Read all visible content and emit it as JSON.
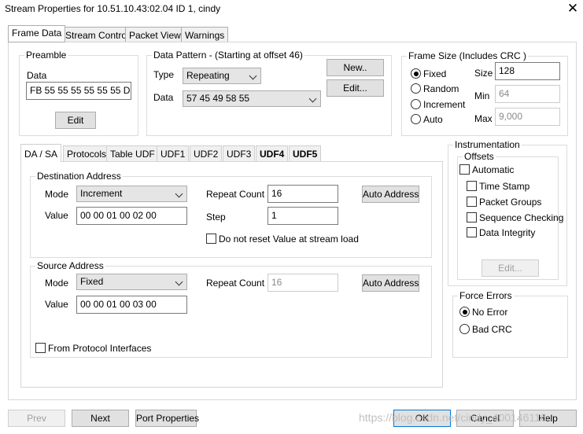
{
  "window": {
    "title": "Stream Properties for 10.51.10.43:02.04  ID 1, cindy",
    "close": "✕"
  },
  "tabs": [
    "Frame Data",
    "Stream Control",
    "Packet View",
    "Warnings"
  ],
  "preamble": {
    "label": "Preamble",
    "data_label": "Data",
    "data_value": "FB 55 55 55 55 55 55 D5",
    "edit": "Edit"
  },
  "pattern": {
    "label": "Data Pattern - (Starting at offset 46)",
    "type_label": "Type",
    "type_value": "Repeating",
    "data_label": "Data",
    "data_value": "57 45 49 58 55",
    "new": "New..",
    "edit": "Edit..."
  },
  "frame_size": {
    "label": "Frame Size  (Includes CRC )",
    "fixed": "Fixed",
    "random": "Random",
    "increment": "Increment",
    "auto": "Auto",
    "size_label": "Size",
    "size_value": "128",
    "min_label": "Min",
    "min_value": "64",
    "max_label": "Max",
    "max_value": "9,000"
  },
  "inner_tabs": [
    "DA / SA",
    "Protocols",
    "Table UDF",
    "UDF1",
    "UDF2",
    "UDF3",
    "UDF4",
    "UDF5"
  ],
  "dest": {
    "label": "Destination Address",
    "mode_label": "Mode",
    "mode_value": "Increment",
    "repeat_label": "Repeat Count",
    "repeat_value": "16",
    "auto": "Auto Address",
    "value_label": "Value",
    "value": "00 00 01 00 02 00",
    "step_label": "Step",
    "step_value": "1",
    "noreset": "Do not reset Value at stream load"
  },
  "src": {
    "label": "Source Address",
    "mode_label": "Mode",
    "mode_value": "Fixed",
    "repeat_label": "Repeat Count",
    "repeat_value": "16",
    "auto": "Auto Address",
    "value_label": "Value",
    "value": "00 00 01 00 03 00"
  },
  "from_proto": "From Protocol Interfaces",
  "instrumentation": {
    "label": "Instrumentation",
    "offsets": "Offsets",
    "automatic": "Automatic",
    "timestamp": "Time Stamp",
    "packet_groups": "Packet Groups",
    "sequence": "Sequence Checking",
    "integrity": "Data Integrity",
    "edit": "Edit..."
  },
  "force_errors": {
    "label": "Force Errors",
    "no_error": "No Error",
    "bad_crc": "Bad CRC"
  },
  "footer": {
    "prev": "Prev",
    "next": "Next",
    "port_props": "Port Properties",
    "ok": "OK",
    "cancel": "Cancel",
    "help": "Help"
  },
  "watermark": "https://blog.csdn.net/cindy_400146116"
}
